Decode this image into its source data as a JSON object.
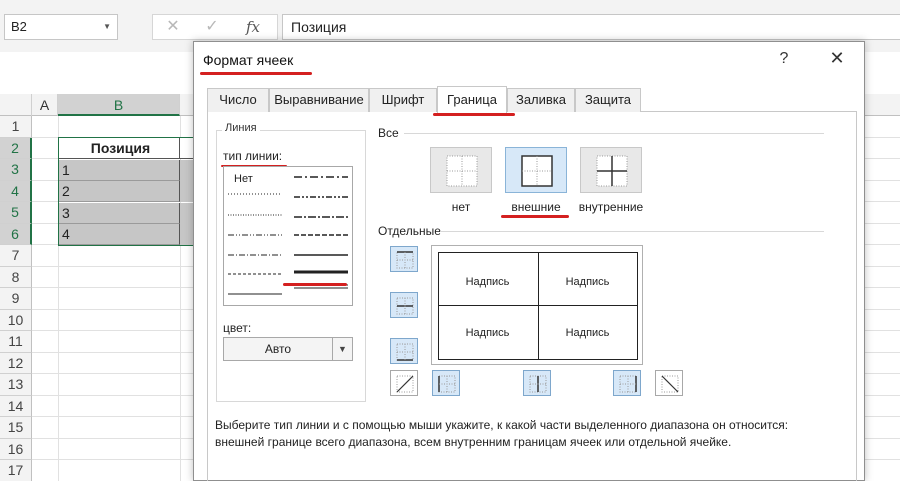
{
  "formula_bar": {
    "name_box": "B2",
    "cancel_glyph": "✕",
    "enter_glyph": "✓",
    "fx_glyph": "fx",
    "formula": "Позиция"
  },
  "sheet": {
    "columns": [
      "A",
      "B"
    ],
    "rows": [
      "1",
      "2",
      "3",
      "4",
      "5",
      "6",
      "7",
      "8",
      "9",
      "10",
      "11",
      "12",
      "13",
      "14",
      "15",
      "16",
      "17"
    ],
    "selected_rows": [
      "2",
      "3",
      "4",
      "5",
      "6"
    ],
    "cells": {
      "header": "Позиция",
      "values": [
        "1",
        "2",
        "3",
        "4"
      ]
    },
    "accent_color": "#217346",
    "fill_color": "#c6c6c6"
  },
  "dialog": {
    "title": "Формат ячеек",
    "help": "?",
    "close": "✕",
    "tabs": [
      {
        "label": "Число",
        "active": false
      },
      {
        "label": "Выравнивание",
        "active": false
      },
      {
        "label": "Шрифт",
        "active": false
      },
      {
        "label": "Граница",
        "active": true
      },
      {
        "label": "Заливка",
        "active": false
      },
      {
        "label": "Защита",
        "active": false
      }
    ],
    "line_group": {
      "legend": "Линия",
      "type_label": "тип линии:",
      "none_label": "Нет",
      "color_label": "цвет:",
      "color_value": "Авто"
    },
    "presets": {
      "label": "Все",
      "items": [
        {
          "label": "нет",
          "selected": false
        },
        {
          "label": "внешние",
          "selected": true
        },
        {
          "label": "внутренние",
          "selected": false
        }
      ]
    },
    "individual": {
      "label": "Отдельные",
      "preview_text": "Надпись"
    },
    "hint": "Выберите тип линии и с помощью мыши укажите, к какой части выделенного диапазона он относится: внешней границе всего диапазона, всем внутренним границам ячеек или отдельной ячейке.",
    "annotation_color": "#d42020"
  }
}
